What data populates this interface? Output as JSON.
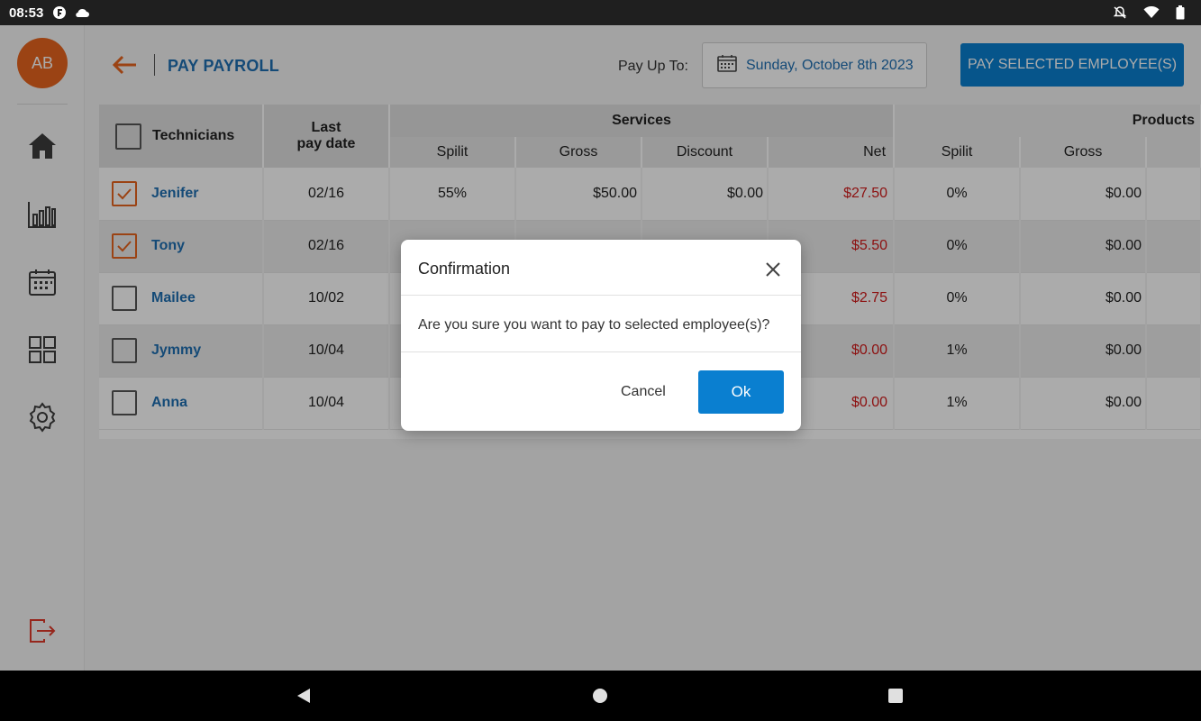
{
  "status_bar": {
    "time": "08:53"
  },
  "sidebar": {
    "avatar_initials": "AB",
    "avatar_color": "#e8651e",
    "nav_items": [
      "home-icon",
      "reports-chart-icon",
      "calendar-icon",
      "apps-grid-icon",
      "settings-gear-icon"
    ],
    "logout_icon": "logout-icon"
  },
  "header": {
    "title": "PAY PAYROLL",
    "pay_up_to_label": "Pay Up To:",
    "pay_up_to_date": "Sunday, October 8th 2023",
    "pay_button_label": "PAY SELECTED EMPLOYEE(S)"
  },
  "table": {
    "technicians_header": "Technicians",
    "last_pay_date_header_line1": "Last",
    "last_pay_date_header_line2": "pay date",
    "services_header": "Services",
    "products_header": "Products",
    "sub_headers": [
      "Spilit",
      "Gross",
      "Discount",
      "Net",
      "Spilit",
      "Gross"
    ],
    "rows": [
      {
        "name": "Jenifer",
        "checked": true,
        "last_pay": "02/16",
        "svc_split": "55%",
        "svc_gross": "$50.00",
        "svc_discount": "$0.00",
        "svc_net": "$27.50",
        "prod_split": "0%",
        "prod_gross": "$0.00"
      },
      {
        "name": "Tony",
        "checked": true,
        "last_pay": "02/16",
        "svc_split": "",
        "svc_gross": "",
        "svc_discount": "",
        "svc_net": "$5.50",
        "prod_split": "0%",
        "prod_gross": "$0.00"
      },
      {
        "name": "Mailee",
        "checked": false,
        "last_pay": "10/02",
        "svc_split": "",
        "svc_gross": "",
        "svc_discount": "",
        "svc_net": "$2.75",
        "prod_split": "0%",
        "prod_gross": "$0.00"
      },
      {
        "name": "Jymmy",
        "checked": false,
        "last_pay": "10/04",
        "svc_split": "",
        "svc_gross": "",
        "svc_discount": "",
        "svc_net": "$0.00",
        "prod_split": "1%",
        "prod_gross": "$0.00"
      },
      {
        "name": "Anna",
        "checked": false,
        "last_pay": "10/04",
        "svc_split": "",
        "svc_gross": "",
        "svc_discount": "",
        "svc_net": "$0.00",
        "prod_split": "1%",
        "prod_gross": "$0.00"
      }
    ]
  },
  "dialog": {
    "title": "Confirmation",
    "message": "Are you sure you want to pay to selected employee(s)?",
    "cancel_label": "Cancel",
    "ok_label": "Ok"
  },
  "colors": {
    "brand_blue": "#1f6fb2",
    "button_blue": "#0a7fd0",
    "accent_orange": "#e8651e",
    "net_red": "#d21b1b"
  }
}
